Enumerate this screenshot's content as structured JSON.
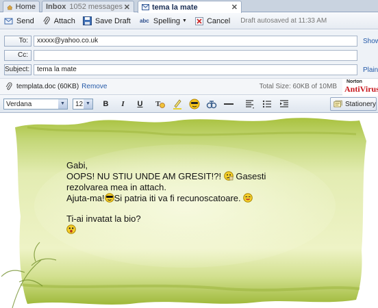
{
  "tabs": [
    {
      "label": "Home"
    },
    {
      "label": "Inbox",
      "count": "1052 messages"
    },
    {
      "label": "tema la mate"
    }
  ],
  "toolbar": {
    "send": "Send",
    "attach": "Attach",
    "save_draft": "Save Draft",
    "spelling": "Spelling",
    "cancel": "Cancel",
    "status": "Draft autosaved at 11:33 AM"
  },
  "fields": {
    "to_label": "To:",
    "to_value": "xxxxx@yahoo.co.uk",
    "to_link": "Show BCC",
    "cc_label": "Cc:",
    "cc_value": "",
    "subject_label": "Subject:",
    "subject_value": "tema la mate",
    "subject_link": "Plain Text"
  },
  "attachment": {
    "name": "templata.doc (60KB)",
    "remove": "Remove",
    "total": "Total Size: 60KB of 10MB",
    "norton_top": "Norton",
    "norton_brand": "AntiVirus"
  },
  "format": {
    "font": "Verdana",
    "size": "12",
    "stationery": "Stationery"
  },
  "message": {
    "line1": "Gabi,",
    "line2": "OOPS! NU STIU UNDE AM GRESIT!?!",
    "line2b": "Gasesti",
    "line3": "rezolvarea mea in attach.",
    "line4a": "Ajuta-ma!",
    "line4b": "Si patria iti va fi recunoscatoare.",
    "line5": "Ti-ai invatat la bio?"
  },
  "colors": {
    "accent": "#2459a8",
    "wash": "#c9d889",
    "norton": "#c8161d"
  }
}
